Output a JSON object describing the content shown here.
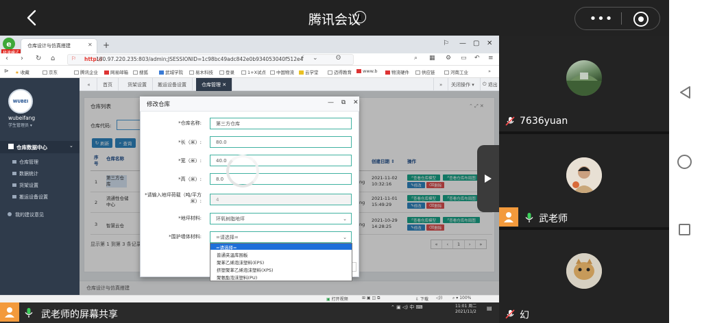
{
  "meeting": {
    "title": "腾讯会议",
    "info_glyph": "i",
    "more_glyph": "•••"
  },
  "participants": [
    {
      "name": "7636yuan",
      "mic": "muted"
    },
    {
      "name": "武老师",
      "mic": "on",
      "avatar_text": "",
      "sharing": true
    },
    {
      "name": "幻",
      "mic": "muted"
    }
  ],
  "share": {
    "label": "武老师的屏幕共享"
  },
  "browser": {
    "logo_text": "e",
    "badge": "极速模式",
    "tab_title": "仓库设计与仿真搭建",
    "url_scheme": "http://",
    "url_rest": "180.97.220.235:803/admin;JSESSIONID=1c98bc49adc842e0b934053040f512e4",
    "bookmarks": [
      "收藏",
      "京东",
      "腾讯企业",
      "网易邮箱",
      "搜狐",
      "武城学院",
      "易木科技",
      "登录",
      "1+X试点",
      "中国物流",
      "云学堂",
      "迈得教育",
      "www.b",
      "物流硬件",
      "供应链",
      "河南工业"
    ],
    "status_items": [
      "打开视频",
      "下载",
      "100%"
    ]
  },
  "app": {
    "username": "wubeifang",
    "role": "学生管理员 ▾",
    "logo_text": "WUBEI",
    "sidebar_center": "仓库数据中心",
    "sidebar_items": [
      "仓库管理",
      "数据统计",
      "货架设置",
      "搬运设备设置"
    ],
    "sidebar_feedback": "我的建议意见",
    "tabs": [
      "首页",
      "货架设置",
      "搬运设备设置",
      "仓库管理 ✕"
    ],
    "tab_right": [
      "关闭操作 ▾",
      "退出"
    ],
    "panel_title": "仓库列表",
    "search_label": "仓库代码:",
    "btn_refresh": "刷新",
    "btn_query": "查询",
    "columns": {
      "no": "序号",
      "name": "仓库名称",
      "date": "创建日期 ⇕",
      "ops": "操作"
    },
    "rows": [
      {
        "no": "1",
        "name": "第三方仓库",
        "date": "2021-11-02 10:32:16"
      },
      {
        "no": "2",
        "name": "流通性仓储中心",
        "date": "2021-11-01 15:49:29"
      },
      {
        "no": "3",
        "name": "智慧云仓",
        "date": "2021-10-29 14:28:25"
      }
    ],
    "row_fragment": "ng",
    "op_labels": {
      "view_model": "查看仓库模型",
      "view_layout": "查看仓库布局图",
      "edit": "修改",
      "delete": "删除"
    },
    "pager_info": "显示第 1 到第 3 条记录",
    "pager": [
      "«",
      "‹",
      "1",
      "›",
      "»"
    ],
    "footer": "仓库设计与仿真搭建"
  },
  "modal": {
    "title": "修改仓库",
    "controls": "— ⧉ ✕",
    "fields": [
      {
        "label": "*仓库名称:",
        "value": "第三方仓库"
      },
      {
        "label": "*长（米）:",
        "value": "80.0"
      },
      {
        "label": "*宽（米）:",
        "value": "40.0"
      },
      {
        "label": "*高（米）:",
        "value": "8.0"
      },
      {
        "label": "*请输入地坪荷载（吨/平方米）:",
        "value": "4"
      },
      {
        "label": "*地坪材料:",
        "value": "环氧树脂地坪"
      },
      {
        "label": "*围护墙体材料:",
        "value": "=请选择="
      }
    ],
    "dropdown_options": [
      "=请选择=",
      "普通夹温库围板",
      "聚苯乙烯泡沫塑料(EPS)",
      "挤塑聚苯乙烯泡沫塑料(XPS)",
      "聚氨酯泡沫塑料(PU)"
    ]
  },
  "taskbar": {
    "time": "11:01 周二",
    "date": "2021/11/2",
    "ime": "中"
  },
  "colors": {
    "accent": "#2e86c1",
    "green": "#18a689",
    "danger": "#e04f4f",
    "sidebar": "#2f3b4b",
    "share_avatar": "#f39a3c"
  }
}
